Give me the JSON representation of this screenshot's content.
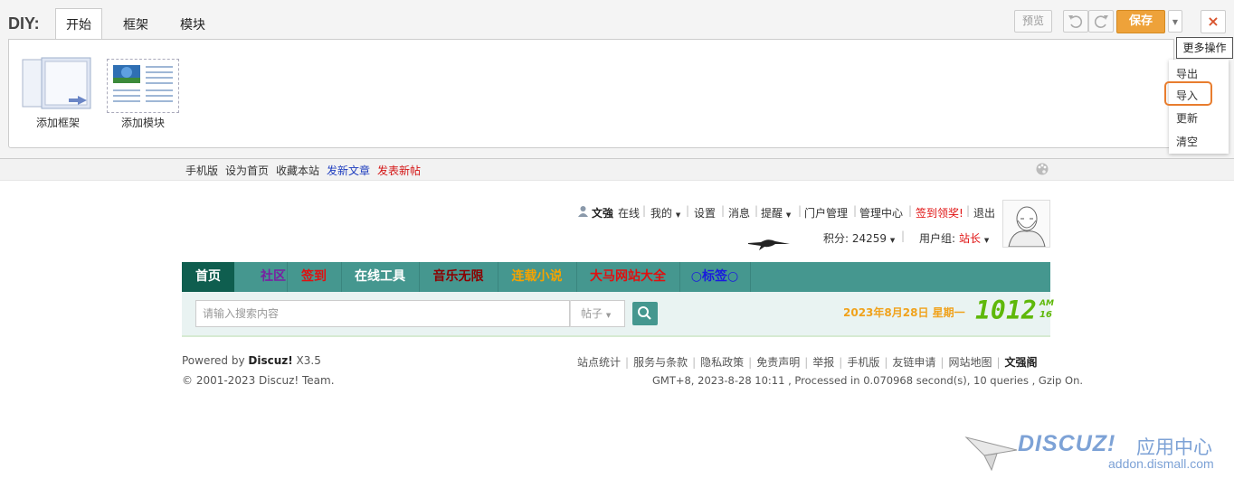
{
  "diy": {
    "title": "DIY:",
    "tabs": [
      "开始",
      "框架",
      "模块"
    ],
    "tools": {
      "add_frame": "添加框架",
      "add_module": "添加模块"
    },
    "preview": "预览",
    "save": "保存",
    "close": "×",
    "more_tip": "更多操作",
    "more_menu": [
      "导出",
      "导入",
      "更新",
      "清空"
    ]
  },
  "topbar": {
    "links": [
      "手机版",
      "设为首页",
      "收藏本站",
      "发新文章",
      "发表新帖"
    ],
    "link_colors": [
      "#333",
      "#333",
      "#333",
      "#1e3dbf",
      "#d41414"
    ]
  },
  "user": {
    "name": "文強",
    "status": "在线",
    "links": [
      "我的",
      "设置",
      "消息",
      "提醒",
      "门户管理",
      "管理中心",
      "签到领奖!",
      "退出"
    ],
    "points_label": "积分: 24259",
    "group_label": "用户组:",
    "group_value": "站长"
  },
  "nav": {
    "items": [
      {
        "label": "首页",
        "color": "#ffffff"
      },
      {
        "label": "社区",
        "color": "#7a1fa2"
      },
      {
        "label": "签到",
        "color": "#e01010"
      },
      {
        "label": "在线工具",
        "color": "#ffffff"
      },
      {
        "label": "音乐无限",
        "color": "#8b0000"
      },
      {
        "label": "连载小说",
        "color": "#f5a300"
      },
      {
        "label": "大马网站大全",
        "color": "#e01010"
      },
      {
        "label": "○标签○",
        "color": "#1a1adf"
      }
    ]
  },
  "search": {
    "placeholder": "请输入搜索内容",
    "type": "帖子",
    "date": "2023年8月28日 星期一",
    "hour": "10",
    "minute": "12",
    "second_top": "AM",
    "second_bottom": "16"
  },
  "footer": {
    "powered_prefix": "Powered by ",
    "powered_brand": "Discuz!",
    "powered_version": " X3.5",
    "copyright": "© 2001-2023 Discuz! Team.",
    "links": [
      "站点统计",
      "服务与条款",
      "隐私政策",
      "免责声明",
      "举报",
      "手机版",
      "友链申请",
      "网站地图",
      "文强阁"
    ],
    "stats": "GMT+8, 2023-8-28 10:11 , Processed in 0.070968 second(s), 10 queries , Gzip On."
  },
  "watermark": {
    "brand": "DISCUZ!",
    "suffix": "应用中心",
    "domain": "addon.dismall.com"
  }
}
